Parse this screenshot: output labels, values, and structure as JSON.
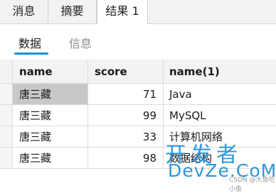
{
  "tabs": [
    {
      "label": "消息"
    },
    {
      "label": "摘要"
    },
    {
      "label": "结果 1"
    }
  ],
  "subtabs": [
    {
      "label": "数据",
      "active": true
    },
    {
      "label": "信息",
      "active": false
    }
  ],
  "accent_color": "#1e8fd6",
  "grid": {
    "columns": [
      "name",
      "score",
      "name(1)"
    ],
    "rows": [
      {
        "name": "唐三藏",
        "score": "71",
        "name1": "Java"
      },
      {
        "name": "唐三藏",
        "score": "99",
        "name1": "MySQL"
      },
      {
        "name": "唐三藏",
        "score": "33",
        "name1": "计算机网络"
      },
      {
        "name": "唐三藏",
        "score": "98",
        "name1": "数据结构"
      }
    ]
  },
  "watermark": {
    "line1": "开发者",
    "line2": "DevZe.CoM",
    "line3": "CSDN @大鱼吃小鱼"
  }
}
